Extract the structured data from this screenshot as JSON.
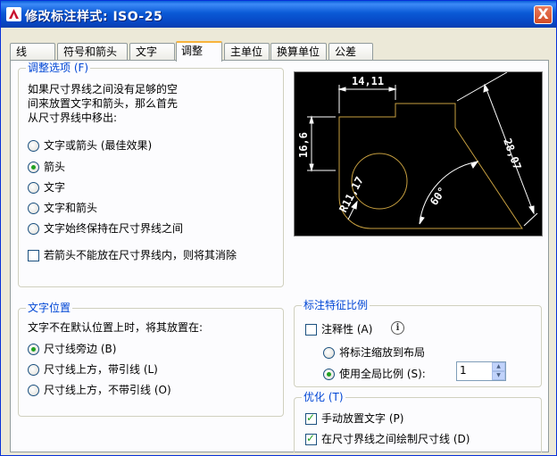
{
  "window": {
    "title": "修改标注样式: ISO-25",
    "close_glyph": "X"
  },
  "tabs": [
    {
      "label": "线"
    },
    {
      "label": "符号和箭头"
    },
    {
      "label": "文字"
    },
    {
      "label": "调整",
      "active": true
    },
    {
      "label": "主单位"
    },
    {
      "label": "换算单位"
    },
    {
      "label": "公差"
    }
  ],
  "fit_options": {
    "legend": "调整选项 (F)",
    "description": [
      "如果尺寸界线之间没有足够的空",
      "间来放置文字和箭头，那么首先",
      "从尺寸界线中移出:"
    ],
    "radios": [
      {
        "label": "文字或箭头 (最佳效果)",
        "selected": false
      },
      {
        "label": "箭头",
        "selected": true
      },
      {
        "label": "文字",
        "selected": false
      },
      {
        "label": "文字和箭头",
        "selected": false
      },
      {
        "label": "文字始终保持在尺寸界线之间",
        "selected": false
      }
    ],
    "suppress_arrows": {
      "label": "若箭头不能放在尺寸界线内，则将其消除",
      "checked": false
    }
  },
  "preview": {
    "dim_top": "14,11",
    "dim_left": "16,6",
    "dim_right": "28,07",
    "dim_radius": "R11,17",
    "dim_angle": "60°",
    "line_color": "#c8a040",
    "dim_color": "#ffffff"
  },
  "text_placement": {
    "legend": "文字位置",
    "description": "文字不在默认位置上时，将其放置在:",
    "radios": [
      {
        "label": "尺寸线旁边 (B)",
        "selected": true
      },
      {
        "label": "尺寸线上方，带引线 (L)",
        "selected": false
      },
      {
        "label": "尺寸线上方，不带引线 (O)",
        "selected": false
      }
    ]
  },
  "scale": {
    "legend": "标注特征比例",
    "annotative": {
      "label": "注释性 (A)",
      "checked": false
    },
    "radios": [
      {
        "label": "将标注缩放到布局",
        "selected": false
      },
      {
        "label": "使用全局比例 (S):",
        "selected": true
      }
    ],
    "global_scale_value": "1"
  },
  "fine_tuning": {
    "legend": "优化 (T)",
    "checks": [
      {
        "label": "手动放置文字 (P)",
        "checked": true
      },
      {
        "label": "在尺寸界线之间绘制尺寸线 (D)",
        "checked": true
      }
    ]
  }
}
